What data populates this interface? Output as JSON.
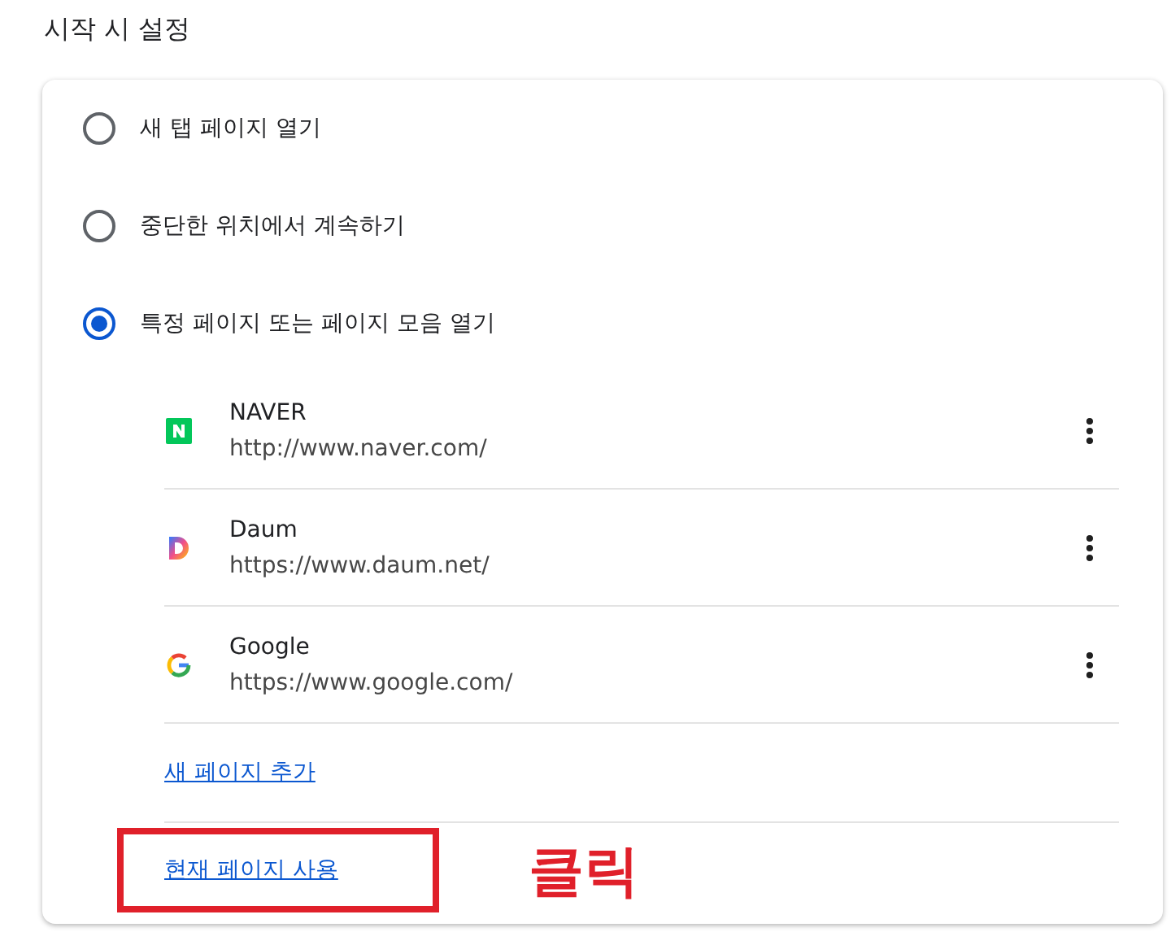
{
  "section_title": "시작 시 설정",
  "options": [
    {
      "label": "새 탭 페이지 열기",
      "selected": false
    },
    {
      "label": "중단한 위치에서 계속하기",
      "selected": false
    },
    {
      "label": "특정 페이지 또는 페이지 모음 열기",
      "selected": true
    }
  ],
  "pages": [
    {
      "kind": "naver",
      "name": "NAVER",
      "url": "http://www.naver.com/"
    },
    {
      "kind": "daum",
      "name": "Daum",
      "url": "https://www.daum.net/"
    },
    {
      "kind": "google",
      "name": "Google",
      "url": "https://www.google.com/"
    }
  ],
  "add_link": "새 페이지 추가",
  "current_link": "현재 페이지 사용",
  "annotation": "클릭"
}
